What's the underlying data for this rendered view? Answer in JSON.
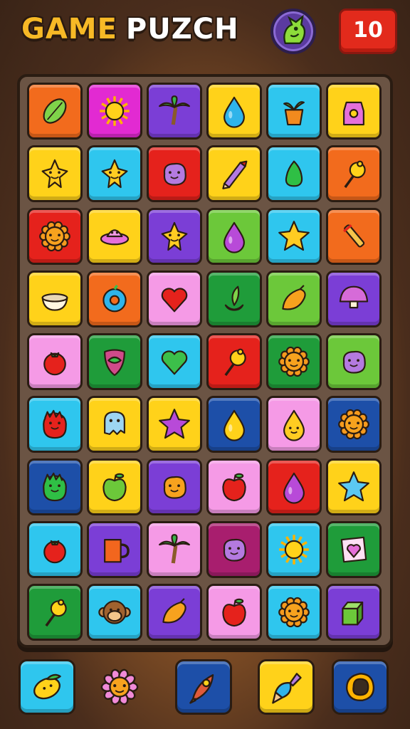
{
  "header": {
    "title_word1": "GAME",
    "title_word2": "PUZCH",
    "score": "10",
    "badge_icon": "dragon-icon"
  },
  "colors": {
    "orange": "#f26b1d",
    "magenta": "#e22ad2",
    "purple": "#7b3ed6",
    "yellow": "#ffd21a",
    "cyan": "#2fc6ee",
    "red": "#e5221c",
    "lime": "#6cc83a",
    "green": "#1f9c3a",
    "pink": "#f59ae6",
    "navy": "#1d4fa8",
    "maroon": "#a81e6e"
  },
  "board": {
    "rows": [
      [
        {
          "bg": "orange",
          "icon": "leaf"
        },
        {
          "bg": "magenta",
          "icon": "sun"
        },
        {
          "bg": "purple",
          "icon": "palm-tree"
        },
        {
          "bg": "yellow",
          "icon": "drop"
        },
        {
          "bg": "cyan",
          "icon": "pot-plant"
        },
        {
          "bg": "yellow",
          "icon": "tag"
        }
      ],
      [
        {
          "bg": "yellow",
          "icon": "star-face"
        },
        {
          "bg": "cyan",
          "icon": "star-face"
        },
        {
          "bg": "red",
          "icon": "blob"
        },
        {
          "bg": "yellow",
          "icon": "pencil"
        },
        {
          "bg": "cyan",
          "icon": "gem"
        },
        {
          "bg": "orange",
          "icon": "lollipop"
        }
      ],
      [
        {
          "bg": "red",
          "icon": "sun-face"
        },
        {
          "bg": "yellow",
          "icon": "ufo"
        },
        {
          "bg": "purple",
          "icon": "star-face"
        },
        {
          "bg": "lime",
          "icon": "drop"
        },
        {
          "bg": "cyan",
          "icon": "star"
        },
        {
          "bg": "orange",
          "icon": "candy"
        }
      ],
      [
        {
          "bg": "yellow",
          "icon": "bowl"
        },
        {
          "bg": "orange",
          "icon": "donut"
        },
        {
          "bg": "pink",
          "icon": "heart"
        },
        {
          "bg": "green",
          "icon": "sprout"
        },
        {
          "bg": "lime",
          "icon": "mango"
        },
        {
          "bg": "purple",
          "icon": "mushroom"
        }
      ],
      [
        {
          "bg": "pink",
          "icon": "tomato"
        },
        {
          "bg": "green",
          "icon": "shield"
        },
        {
          "bg": "cyan",
          "icon": "heart"
        },
        {
          "bg": "red",
          "icon": "lollipop"
        },
        {
          "bg": "green",
          "icon": "sun-face"
        },
        {
          "bg": "lime",
          "icon": "blob"
        }
      ],
      [
        {
          "bg": "cyan",
          "icon": "monster"
        },
        {
          "bg": "yellow",
          "icon": "ghost"
        },
        {
          "bg": "yellow",
          "icon": "star"
        },
        {
          "bg": "navy",
          "icon": "drop"
        },
        {
          "bg": "pink",
          "icon": "drop-face"
        },
        {
          "bg": "navy",
          "icon": "sun-face"
        }
      ],
      [
        {
          "bg": "navy",
          "icon": "monster"
        },
        {
          "bg": "yellow",
          "icon": "apple"
        },
        {
          "bg": "purple",
          "icon": "blob"
        },
        {
          "bg": "pink",
          "icon": "apple"
        },
        {
          "bg": "red",
          "icon": "drop"
        },
        {
          "bg": "yellow",
          "icon": "star"
        }
      ],
      [
        {
          "bg": "cyan",
          "icon": "tomato"
        },
        {
          "bg": "purple",
          "icon": "mug"
        },
        {
          "bg": "pink",
          "icon": "palm-tree"
        },
        {
          "bg": "maroon",
          "icon": "blob"
        },
        {
          "bg": "cyan",
          "icon": "sun"
        },
        {
          "bg": "green",
          "icon": "heart-card"
        }
      ],
      [
        {
          "bg": "green",
          "icon": "lollipop"
        },
        {
          "bg": "cyan",
          "icon": "monkey"
        },
        {
          "bg": "purple",
          "icon": "mango"
        },
        {
          "bg": "pink",
          "icon": "apple"
        },
        {
          "bg": "cyan",
          "icon": "sun-face"
        },
        {
          "bg": "purple",
          "icon": "carton"
        }
      ]
    ]
  },
  "powerups": [
    {
      "name": "lemon-powerup",
      "bg": "cyan",
      "icon": "lemon"
    },
    {
      "name": "flower-decor",
      "bg": "",
      "icon": "flower"
    },
    {
      "name": "rocket-powerup",
      "bg": "navy",
      "icon": "rocket"
    },
    {
      "name": "brush-powerup",
      "bg": "yellow",
      "icon": "brush"
    },
    {
      "name": "shape-powerup",
      "bg": "navy",
      "icon": "ring"
    }
  ]
}
